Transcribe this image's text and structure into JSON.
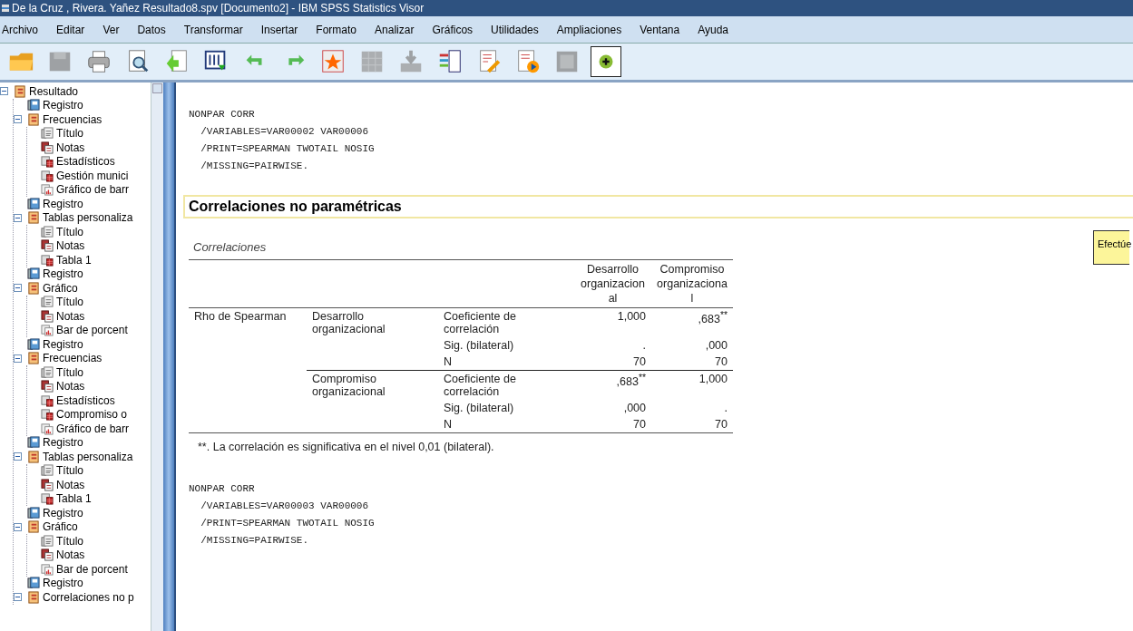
{
  "window": {
    "title": "De la Cruz , Rivera. Yañez Resultado8.spv [Documento2] - IBM SPSS Statistics Visor"
  },
  "menu": [
    "Archivo",
    "Editar",
    "Ver",
    "Datos",
    "Transformar",
    "Insertar",
    "Formato",
    "Analizar",
    "Gráficos",
    "Utilidades",
    "Ampliaciones",
    "Ventana",
    "Ayuda"
  ],
  "toolbar": [
    {
      "kind": "open",
      "disabled": false
    },
    {
      "kind": "save",
      "disabled": true
    },
    {
      "kind": "print",
      "disabled": false
    },
    {
      "kind": "preview",
      "disabled": false
    },
    {
      "kind": "export",
      "disabled": false
    },
    {
      "kind": "recall",
      "disabled": false
    },
    {
      "kind": "undo",
      "disabled": false
    },
    {
      "kind": "redo",
      "disabled": false
    },
    {
      "kind": "goto",
      "disabled": false
    },
    {
      "kind": "grid",
      "disabled": true
    },
    {
      "kind": "insert",
      "disabled": true
    },
    {
      "kind": "variables",
      "disabled": false
    },
    {
      "kind": "editor",
      "disabled": false
    },
    {
      "kind": "run",
      "disabled": false
    },
    {
      "kind": "square",
      "disabled": true
    },
    {
      "kind": "add",
      "disabled": false,
      "pressed": true
    }
  ],
  "outline": {
    "label": "Resultado",
    "kind": "folder",
    "expanded": true,
    "children": [
      {
        "label": "Registro",
        "kind": "log"
      },
      {
        "label": "Frecuencias",
        "kind": "folder",
        "expanded": true,
        "children": [
          {
            "label": "Título",
            "kind": "title"
          },
          {
            "label": "Notas",
            "kind": "notes"
          },
          {
            "label": "Estadísticos",
            "kind": "table"
          },
          {
            "label": "Gestión munici",
            "kind": "table"
          },
          {
            "label": "Gráfico de barr",
            "kind": "chart"
          }
        ]
      },
      {
        "label": "Registro",
        "kind": "log"
      },
      {
        "label": "Tablas personaliza",
        "kind": "folder",
        "expanded": true,
        "children": [
          {
            "label": "Título",
            "kind": "title"
          },
          {
            "label": "Notas",
            "kind": "notes"
          },
          {
            "label": "Tabla 1",
            "kind": "table"
          }
        ]
      },
      {
        "label": "Registro",
        "kind": "log"
      },
      {
        "label": "Gráfico",
        "kind": "folder",
        "expanded": true,
        "children": [
          {
            "label": "Título",
            "kind": "title"
          },
          {
            "label": "Notas",
            "kind": "notes"
          },
          {
            "label": "Bar de porcent",
            "kind": "chart"
          }
        ]
      },
      {
        "label": "Registro",
        "kind": "log"
      },
      {
        "label": "Frecuencias",
        "kind": "folder",
        "expanded": true,
        "children": [
          {
            "label": "Título",
            "kind": "title"
          },
          {
            "label": "Notas",
            "kind": "notes"
          },
          {
            "label": "Estadísticos",
            "kind": "table"
          },
          {
            "label": "Compromiso o",
            "kind": "table"
          },
          {
            "label": "Gráfico de barr",
            "kind": "chart"
          }
        ]
      },
      {
        "label": "Registro",
        "kind": "log"
      },
      {
        "label": "Tablas personaliza",
        "kind": "folder",
        "expanded": true,
        "children": [
          {
            "label": "Título",
            "kind": "title"
          },
          {
            "label": "Notas",
            "kind": "notes"
          },
          {
            "label": "Tabla 1",
            "kind": "table"
          }
        ]
      },
      {
        "label": "Registro",
        "kind": "log"
      },
      {
        "label": "Gráfico",
        "kind": "folder",
        "expanded": true,
        "children": [
          {
            "label": "Título",
            "kind": "title"
          },
          {
            "label": "Notas",
            "kind": "notes"
          },
          {
            "label": "Bar de porcent",
            "kind": "chart"
          }
        ]
      },
      {
        "label": "Registro",
        "kind": "log"
      },
      {
        "label": "Correlaciones no p",
        "kind": "folder",
        "expanded": true
      }
    ]
  },
  "output": [
    {
      "kind": "syntax",
      "lines": [
        "NONPAR CORR",
        "  /VARIABLES=VAR00002 VAR00006",
        "  /PRINT=SPEARMAN TWOTAIL NOSIG",
        "  /MISSING=PAIRWISE."
      ]
    },
    {
      "kind": "heading",
      "text": "Correlaciones no paramétricas",
      "selected": true
    },
    {
      "kind": "table",
      "title": "Correlaciones",
      "columns": [
        "Desarrollo organizacional",
        "Compromiso organizacional"
      ],
      "group": "Rho de Spearman",
      "blocks": [
        {
          "variable": "Desarrollo organizacional",
          "rows": [
            {
              "stat": "Coeficiente de correlación",
              "values": [
                "1,000",
                ",683$^{**}$"
              ]
            },
            {
              "stat": "Sig. (bilateral)",
              "values": [
                ".",
                ",000"
              ]
            },
            {
              "stat": "N",
              "values": [
                "70",
                "70"
              ]
            }
          ]
        },
        {
          "variable": "Compromiso organizacional",
          "rows": [
            {
              "stat": "Coeficiente de correlación",
              "values": [
                ",683$^{**}$",
                "1,000"
              ]
            },
            {
              "stat": "Sig. (bilateral)",
              "values": [
                ",000",
                "."
              ]
            },
            {
              "stat": "N",
              "values": [
                "70",
                "70"
              ]
            }
          ]
        }
      ],
      "footnote": "**. La correlación es significativa en el nivel 0,01 (bilateral)."
    },
    {
      "kind": "syntax",
      "lines": [
        "NONPAR CORR",
        "  /VARIABLES=VAR00003 VAR00006",
        "  /PRINT=SPEARMAN TWOTAIL NOSIG",
        "  /MISSING=PAIRWISE."
      ]
    }
  ],
  "tooltip": "Efectúe"
}
